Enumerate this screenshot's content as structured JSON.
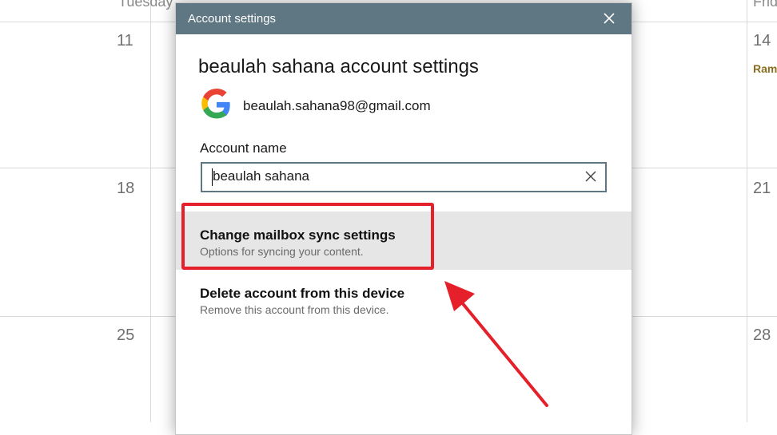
{
  "calendar": {
    "day_headers": [
      "Tuesday",
      "Friday"
    ],
    "dates": [
      "11",
      "14",
      "18",
      "21",
      "25",
      "28"
    ],
    "event_snippet": "Ram"
  },
  "dialog": {
    "title": "Account settings",
    "heading": "beaulah sahana account settings",
    "email": "beaulah.sahana98@gmail.com",
    "account_name_label": "Account name",
    "account_name_value": "beaulah sahana",
    "options": [
      {
        "title": "Change mailbox sync settings",
        "subtitle": "Options for syncing your content."
      },
      {
        "title": "Delete account from this device",
        "subtitle": "Remove this account from this device."
      }
    ]
  },
  "colors": {
    "titlebar": "#5f7683",
    "highlight_box": "#e5202a",
    "selected_option_bg": "#e6e6e6"
  },
  "icons": [
    "close-icon",
    "google-logo-icon",
    "clear-text-icon",
    "annotation-arrow"
  ]
}
